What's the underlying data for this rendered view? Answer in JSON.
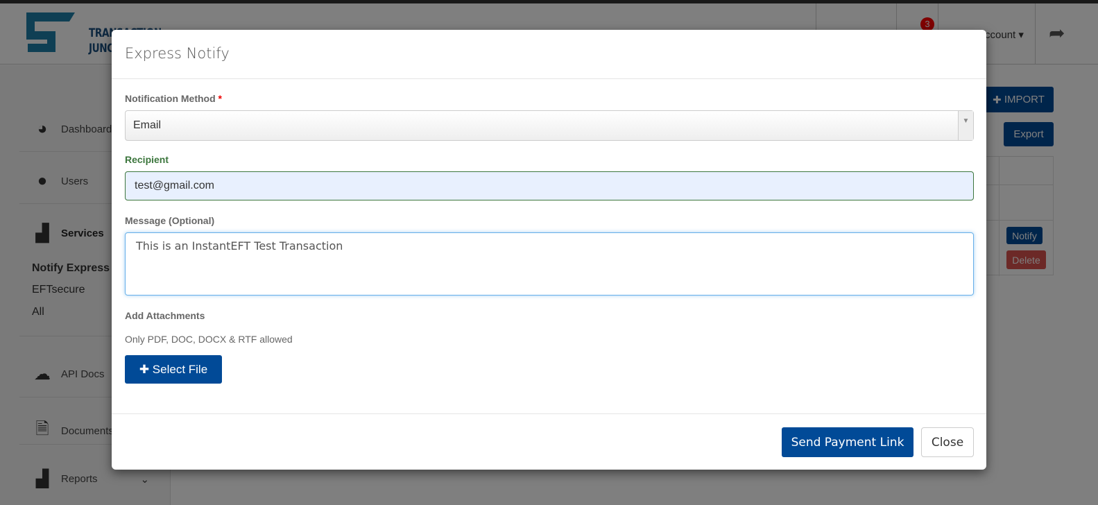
{
  "header": {
    "logo_text_line1": "TRANSACTION",
    "logo_text_line2": "JUNCTION",
    "notification_count": "3",
    "account_label": "Account ▾",
    "share_icon": "share-icon"
  },
  "sidebar": {
    "items": [
      {
        "label": "Dashboard",
        "icon": "dashboard-icon"
      },
      {
        "label": "Users",
        "icon": "user-icon"
      },
      {
        "label": "Services",
        "icon": "bar-chart-icon"
      },
      {
        "label": "API Docs",
        "icon": "cloud-download-icon"
      },
      {
        "label": "Documents",
        "icon": "document-icon"
      },
      {
        "label": "Reports",
        "icon": "bar-chart-icon"
      }
    ],
    "sub_items": [
      "Notify Express",
      "EFTsecure",
      "All"
    ]
  },
  "main": {
    "import_label": "IMPORT",
    "export_label": "Export",
    "notify_label": "Notify",
    "delete_label": "Delete"
  },
  "modal": {
    "title": "Express Notify",
    "method_label": "Notification Method",
    "required_mark": "*",
    "method_value": "Email",
    "recipient_label": "Recipient",
    "recipient_value": "test@gmail.com",
    "message_label": "Message (Optional)",
    "message_value": "This is an InstantEFT Test Transaction",
    "attachments_label": "Add Attachments",
    "attachments_help": "Only PDF, DOC, DOCX & RTF allowed",
    "select_file_label": "Select File",
    "send_label": "Send Payment Link",
    "close_label": "Close"
  },
  "colors": {
    "primary": "#014a97",
    "danger": "#d9534f",
    "success": "#3c763d",
    "badge": "#ff0000"
  }
}
